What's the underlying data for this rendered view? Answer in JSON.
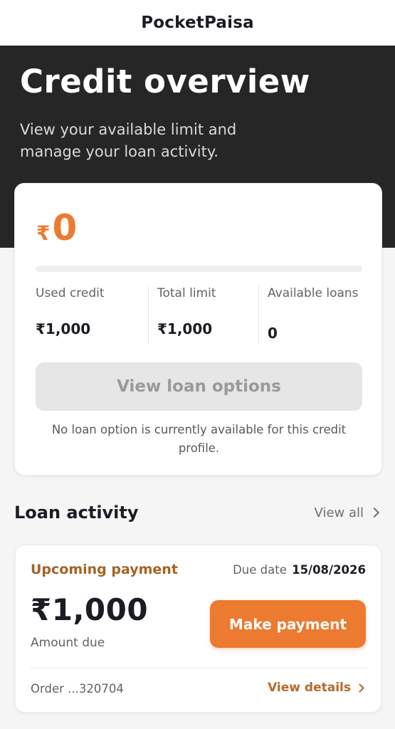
{
  "app": {
    "title": "PocketPaisa"
  },
  "hero": {
    "title": "Credit overview",
    "subtitle": "View your available limit and manage your loan activity."
  },
  "credit": {
    "currency_symbol": "₹",
    "available_amount": "0",
    "usage_fraction": 0,
    "stats": [
      {
        "label": "Used credit",
        "value": "₹1,000"
      },
      {
        "label": "Total limit",
        "value": "₹1,000"
      },
      {
        "label": "Available loans",
        "value": "0"
      }
    ],
    "view_options_label": "View loan options",
    "no_loan_note": "No loan option is currently available for this credit profile."
  },
  "activity": {
    "title": "Loan activity",
    "view_all_label": "View all",
    "loan": {
      "status": "Upcoming payment",
      "due_label": "Due date",
      "due_date": "15/08/2026",
      "amount": "₹1,000",
      "amount_label": "Amount due",
      "pay_label": "Make payment",
      "order_label": "Order ...320704",
      "details_label": "View details"
    }
  },
  "colors": {
    "accent": "#ec7a30",
    "hero_background": "#262626",
    "status_text": "#a56324"
  },
  "icons": [
    "chevron-right-icon"
  ]
}
